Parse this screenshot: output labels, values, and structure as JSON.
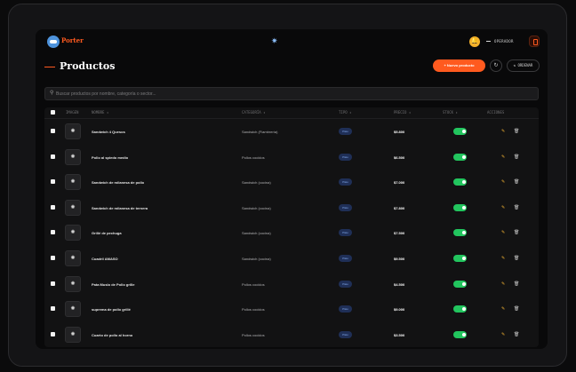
{
  "header": {
    "brand": "Porter",
    "theme_icon": "sun-icon",
    "role": "OPERADOR"
  },
  "page": {
    "title": "Productos",
    "new_button": "+ Nuevo producto",
    "order_button": "⇅ ORDENAR"
  },
  "search": {
    "placeholder": "Buscar productos por nombre, categoría o sector..."
  },
  "table": {
    "columns": [
      "IMAGEN",
      "NOMBRE ↕",
      "CATEGORÍA ↕",
      "TIPO ↕",
      "PRECIO ↕",
      "STOCK ↕",
      "ACCIONES"
    ],
    "rows": [
      {
        "name": "Sandwich 4 Quesos",
        "category": "Sandwich (Fiambrería)",
        "type": "Plato",
        "price": "$5.800",
        "stock": true
      },
      {
        "name": "Pollo al spiedo medio",
        "category": "Pollos cocidos",
        "type": "Plato",
        "price": "$6.500",
        "stock": true
      },
      {
        "name": "Sandwich de milanesa de pollo",
        "category": "Sandwich (cocina)",
        "type": "Plato",
        "price": "$7.000",
        "stock": true
      },
      {
        "name": "Sandwich de milanesa de ternera",
        "category": "Sandwich (cocina)",
        "type": "Plato",
        "price": "$7.800",
        "stock": true
      },
      {
        "name": "Grillé de pechuga",
        "category": "Sandwich (cocina)",
        "type": "Plato",
        "price": "$7.500",
        "stock": true
      },
      {
        "name": "Cuadril AMASO",
        "category": "Sandwich (cocina)",
        "type": "Plato",
        "price": "$9.500",
        "stock": true
      },
      {
        "name": "Pata Muslo de Pollo grille",
        "category": "Pollos cocidos",
        "type": "Plato",
        "price": "$4.500",
        "stock": true
      },
      {
        "name": "suprema de pollo grillé",
        "category": "Pollos cocidos",
        "type": "Plato",
        "price": "$9.000",
        "stock": true
      },
      {
        "name": "Cuarto de pollo al horno",
        "category": "Pollos cocidos",
        "type": "Plato",
        "price": "$3.500",
        "stock": true
      }
    ]
  },
  "colors": {
    "accent": "#ff5a1f",
    "stock_on": "#22c55e",
    "type_badge": "#1f2f57"
  }
}
